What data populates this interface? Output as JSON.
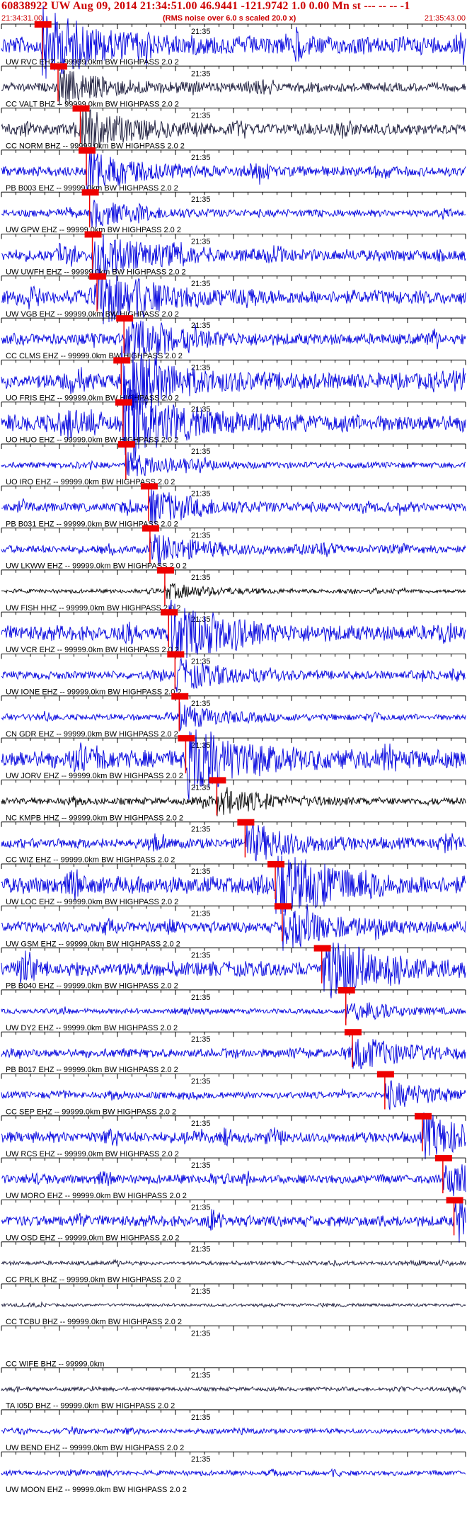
{
  "header": {
    "title": "60838922 UW Aug 09, 2014 21:34:51.00   46.9441 -121.9742  1.0 0.00 Mn st --- -- --   -1",
    "start_time": "21:34:31.00",
    "note": "(RMS noise over 6.0 s scaled 20.0 x)",
    "end_time": "21:35:43.00"
  },
  "chart_data": {
    "type": "line",
    "tick_label": "21:35",
    "colors": {
      "trace": "#0000dd",
      "trace_dark": "#1a1a3a",
      "trace_black": "#000000",
      "pick": "#ee0000",
      "axis": "#000000"
    },
    "stations": [
      {
        "label": "UW RVC EHZ -- 99999.0km BW  HIGHPASS  2.0  2",
        "pick": 0.088,
        "amp": 0.9,
        "color": "trace"
      },
      {
        "label": "CC VALT BHZ -- 99999.0km BW  HIGHPASS  2.0  2",
        "pick": 0.122,
        "amp": 0.45,
        "color": "trace_dark"
      },
      {
        "label": "CC NORM BHZ -- 99999.0km BW  HIGHPASS  2.0  2",
        "pick": 0.17,
        "amp": 0.55,
        "color": "trace_dark"
      },
      {
        "label": "PB B003 EHZ -- 99999.0km BW  HIGHPASS  2.0  2",
        "pick": 0.183,
        "amp": 0.5,
        "color": "trace"
      },
      {
        "label": "UW GPW EHZ -- 99999.0km BW  HIGHPASS  2.0  2",
        "pick": 0.19,
        "amp": 0.35,
        "color": "trace"
      },
      {
        "label": "UW UWFH EHZ -- 99999.0km BW  HIGHPASS  2.0  2",
        "pick": 0.196,
        "amp": 0.6,
        "color": "trace"
      },
      {
        "label": "UW VGB EHZ -- 99999.0km BW  HIGHPASS  2.0  2",
        "pick": 0.206,
        "amp": 0.7,
        "color": "trace"
      },
      {
        "label": "CC CLMS EHZ -- 99999.0km BW  HIGHPASS  2.0  2",
        "pick": 0.264,
        "amp": 0.55,
        "color": "trace"
      },
      {
        "label": "UO FRIS EHZ -- 99999.0km BW  HIGHPASS  2.0  2",
        "pick": 0.258,
        "amp": 0.8,
        "color": "trace"
      },
      {
        "label": "UO HUO EHZ -- 99999.0km BW  HIGHPASS  2.0  2",
        "pick": 0.262,
        "amp": 0.85,
        "color": "trace"
      },
      {
        "label": "UO IRO EHZ -- 99999.0km BW  HIGHPASS  2.0  2",
        "pick": 0.268,
        "amp": 0.3,
        "color": "trace"
      },
      {
        "label": "PB B031 EHZ -- 99999.0km BW  HIGHPASS  2.0  2",
        "pick": 0.317,
        "amp": 0.45,
        "color": "trace"
      },
      {
        "label": "UW LKWW EHZ -- 99999.0km BW  HIGHPASS  2.0  2",
        "pick": 0.32,
        "amp": 0.4,
        "color": "trace"
      },
      {
        "label": "UW FISH HHZ -- 99999.0km BW  HIGHPASS  2.0  2",
        "pick": 0.352,
        "amp": 0.2,
        "color": "trace_black"
      },
      {
        "label": "UW VCR EHZ -- 99999.0km BW  HIGHPASS  2.0  2",
        "pick": 0.36,
        "amp": 0.75,
        "color": "trace"
      },
      {
        "label": "UW IONE EHZ -- 99999.0km BW  HIGHPASS  2.0  2",
        "pick": 0.374,
        "amp": 0.4,
        "color": "trace"
      },
      {
        "label": "CN GDR EHZ -- 99999.0km BW  HIGHPASS  2.0  2",
        "pick": 0.383,
        "amp": 0.3,
        "color": "trace"
      },
      {
        "label": "UW JORV EHZ -- 99999.0km BW  HIGHPASS  2.0  2",
        "pick": 0.397,
        "amp": 0.9,
        "color": "trace"
      },
      {
        "label": "NC KMPB HHZ -- 99999.0km BW  HIGHPASS  2.0  2",
        "pick": 0.464,
        "amp": 0.35,
        "color": "trace_black"
      },
      {
        "label": "CC WIZ EHZ -- 99999.0km BW  HIGHPASS  2.0  2",
        "pick": 0.525,
        "amp": 0.5,
        "color": "trace"
      },
      {
        "label": "UW LOC EHZ -- 99999.0km BW  HIGHPASS  2.0  2",
        "pick": 0.59,
        "amp": 0.85,
        "color": "trace"
      },
      {
        "label": "UW GSM EHZ -- 99999.0km BW  HIGHPASS  2.0  2",
        "pick": 0.605,
        "amp": 0.55,
        "color": "trace"
      },
      {
        "label": "PB B040 EHZ -- 99999.0km BW  HIGHPASS  2.0  2",
        "pick": 0.69,
        "amp": 0.75,
        "color": "trace"
      },
      {
        "label": "UW DY2 EHZ -- 99999.0km BW  HIGHPASS  2.0  2",
        "pick": 0.742,
        "amp": 0.25,
        "color": "trace"
      },
      {
        "label": "PB B017 EHZ -- 99999.0km BW  HIGHPASS  2.0  2",
        "pick": 0.756,
        "amp": 0.45,
        "color": "trace"
      },
      {
        "label": "CC SEP EHZ -- 99999.0km BW  HIGHPASS  2.0  2",
        "pick": 0.826,
        "amp": 0.35,
        "color": "trace"
      },
      {
        "label": "UW RCS EHZ -- 99999.0km BW  HIGHPASS  2.0  2",
        "pick": 0.907,
        "amp": 0.55,
        "color": "trace"
      },
      {
        "label": "UW MORO EHZ -- 99999.0km BW  HIGHPASS  2.0  2",
        "pick": 0.951,
        "amp": 0.45,
        "color": "trace"
      },
      {
        "label": "UW OSD EHZ -- 99999.0km BW  HIGHPASS  2.0  2",
        "pick": 0.975,
        "amp": 0.55,
        "color": "trace"
      },
      {
        "label": "CC PRLK BHZ -- 99999.0km BW  HIGHPASS  2.0  2",
        "pick": null,
        "amp": 0.2,
        "color": "trace_dark"
      },
      {
        "label": "CC TCBU BHZ -- 99999.0km BW  HIGHPASS  2.0  2",
        "pick": null,
        "amp": 0.15,
        "color": "trace_dark"
      },
      {
        "label": "CC WIFE BHZ -- 99999.0km",
        "pick": null,
        "amp": 0.0,
        "color": "trace_dark"
      },
      {
        "label": "TA I05D BHZ -- 99999.0km BW  HIGHPASS  2.0  2",
        "pick": null,
        "amp": 0.2,
        "color": "trace_dark"
      },
      {
        "label": "UW BEND EHZ -- 99999.0km BW  HIGHPASS  2.0  2",
        "pick": null,
        "amp": 0.25,
        "color": "trace"
      },
      {
        "label": "UW MOON EHZ -- 99999.0km BW  HIGHPASS  2.0  2",
        "pick": null,
        "amp": 0.25,
        "color": "trace"
      }
    ]
  }
}
